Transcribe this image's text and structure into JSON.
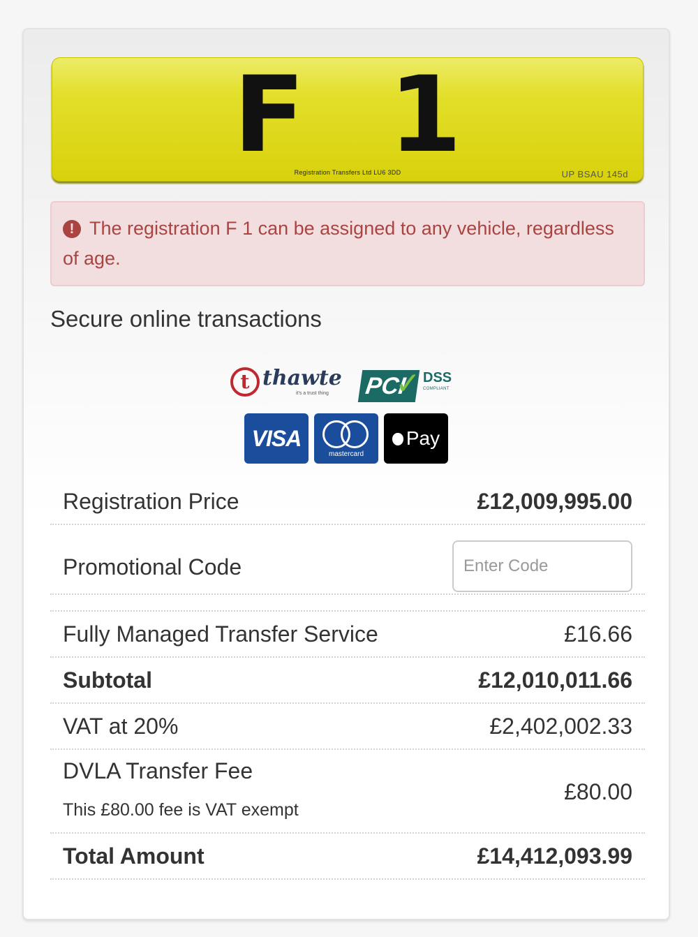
{
  "plate": {
    "registration": "F 1",
    "dealer_text": "Registration Transfers Ltd LU6 3DD",
    "standard_code": "UP BSAU 145d"
  },
  "alert": {
    "icon": "exclamation-circle-icon",
    "message": "The registration F 1 can be assigned to any vehicle, regardless of age."
  },
  "secure": {
    "heading": "Secure online transactions",
    "thawte": {
      "brand": "thawte",
      "tagline": "it's a trust thing",
      "letter": "t"
    },
    "pci": {
      "brand": "PCI",
      "dss": "DSS",
      "compliant": "COMPLIANT"
    },
    "cards": {
      "visa": "VISA",
      "mastercard": "mastercard",
      "applepay": "Pay"
    }
  },
  "pricing": {
    "registration_price": {
      "label": "Registration Price",
      "amount": "£12,009,995.00"
    },
    "promo": {
      "label": "Promotional Code",
      "placeholder": "Enter Code",
      "value": ""
    },
    "transfer_service": {
      "label": "Fully Managed Transfer Service",
      "amount": "£16.66"
    },
    "subtotal": {
      "label": "Subtotal",
      "amount": "£12,010,011.66"
    },
    "vat": {
      "label": "VAT at 20%",
      "amount": "£2,402,002.33"
    },
    "dvla": {
      "label": "DVLA Transfer Fee",
      "note": "This £80.00 fee is VAT exempt",
      "amount": "£80.00"
    },
    "total": {
      "label": "Total Amount",
      "amount": "£14,412,093.99"
    }
  },
  "colors": {
    "plate_yellow": "#e3df2a",
    "alert_bg": "#f2dede",
    "alert_text": "#a94442",
    "visa_blue": "#1a4d9c",
    "pci_teal": "#1b6a64",
    "thawte_red": "#c0282f"
  }
}
